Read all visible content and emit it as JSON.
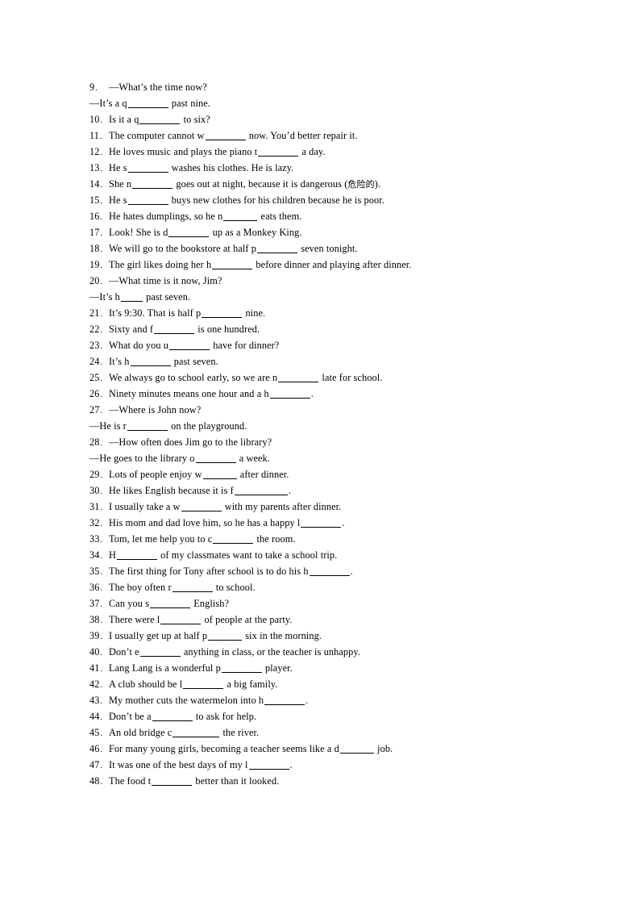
{
  "document": {
    "type": "worksheet",
    "page_background": "#ffffff",
    "text_color": "#000000",
    "items": [
      {
        "number": "9",
        "lines": [
          {
            "kind": "numbered",
            "parts": [
              {
                "t": "text",
                "v": "—What’s the time now?"
              }
            ]
          },
          {
            "kind": "cont",
            "parts": [
              {
                "t": "text",
                "v": "—It’s a q"
              },
              {
                "t": "blank",
                "size": "m"
              },
              {
                "t": "text",
                "v": " past nine."
              }
            ]
          }
        ]
      },
      {
        "number": "10",
        "lines": [
          {
            "kind": "numbered",
            "parts": [
              {
                "t": "text",
                "v": "Is it a q"
              },
              {
                "t": "blank",
                "size": "m"
              },
              {
                "t": "text",
                "v": " to six?"
              }
            ]
          }
        ]
      },
      {
        "number": "11",
        "lines": [
          {
            "kind": "numbered",
            "parts": [
              {
                "t": "text",
                "v": "The computer cannot w"
              },
              {
                "t": "blank",
                "size": "m"
              },
              {
                "t": "text",
                "v": " now. You’d better repair it."
              }
            ]
          }
        ]
      },
      {
        "number": "12",
        "lines": [
          {
            "kind": "numbered",
            "parts": [
              {
                "t": "text",
                "v": "He loves music and plays the piano t"
              },
              {
                "t": "blank",
                "size": "m"
              },
              {
                "t": "text",
                "v": " a day."
              }
            ]
          }
        ]
      },
      {
        "number": "13",
        "lines": [
          {
            "kind": "numbered",
            "parts": [
              {
                "t": "text",
                "v": "He s"
              },
              {
                "t": "blank",
                "size": "m"
              },
              {
                "t": "text",
                "v": " washes his clothes. He is lazy."
              }
            ]
          }
        ]
      },
      {
        "number": "14",
        "lines": [
          {
            "kind": "numbered",
            "parts": [
              {
                "t": "text",
                "v": "She n"
              },
              {
                "t": "blank",
                "size": "m"
              },
              {
                "t": "text",
                "v": " goes out at night, because it is dangerous ("
              },
              {
                "t": "cn",
                "v": "危险的"
              },
              {
                "t": "text",
                "v": ")."
              }
            ]
          }
        ]
      },
      {
        "number": "15",
        "lines": [
          {
            "kind": "numbered",
            "parts": [
              {
                "t": "text",
                "v": "He s"
              },
              {
                "t": "blank",
                "size": "m"
              },
              {
                "t": "text",
                "v": " buys new clothes for his children because he is poor."
              }
            ]
          }
        ]
      },
      {
        "number": "16",
        "lines": [
          {
            "kind": "numbered",
            "parts": [
              {
                "t": "text",
                "v": "He hates dumplings, so he n"
              },
              {
                "t": "blank",
                "size": "s"
              },
              {
                "t": "text",
                "v": " eats them."
              }
            ]
          }
        ]
      },
      {
        "number": "17",
        "lines": [
          {
            "kind": "numbered",
            "parts": [
              {
                "t": "text",
                "v": "Look! She is d"
              },
              {
                "t": "blank",
                "size": "m"
              },
              {
                "t": "text",
                "v": " up as a Monkey King."
              }
            ]
          }
        ]
      },
      {
        "number": "18",
        "lines": [
          {
            "kind": "numbered",
            "parts": [
              {
                "t": "text",
                "v": "We will go to the bookstore at half p"
              },
              {
                "t": "blank",
                "size": "m"
              },
              {
                "t": "text",
                "v": " seven tonight."
              }
            ]
          }
        ]
      },
      {
        "number": "19",
        "lines": [
          {
            "kind": "numbered",
            "parts": [
              {
                "t": "text",
                "v": "The girl likes doing her h"
              },
              {
                "t": "blank",
                "size": "m"
              },
              {
                "t": "text",
                "v": " before dinner and playing after dinner."
              }
            ]
          }
        ]
      },
      {
        "number": "20",
        "lines": [
          {
            "kind": "numbered",
            "parts": [
              {
                "t": "text",
                "v": "—What time is it now, Jim?"
              }
            ]
          },
          {
            "kind": "cont",
            "parts": [
              {
                "t": "text",
                "v": "—It’s h"
              },
              {
                "t": "blank",
                "size": "xs"
              },
              {
                "t": "text",
                "v": " past seven."
              }
            ]
          }
        ]
      },
      {
        "number": "21",
        "lines": [
          {
            "kind": "numbered",
            "parts": [
              {
                "t": "text",
                "v": "It’s 9:30. That is half p"
              },
              {
                "t": "blank",
                "size": "m"
              },
              {
                "t": "text",
                "v": " nine."
              }
            ]
          }
        ]
      },
      {
        "number": "22",
        "lines": [
          {
            "kind": "numbered",
            "parts": [
              {
                "t": "text",
                "v": "Sixty and f"
              },
              {
                "t": "blank",
                "size": "m"
              },
              {
                "t": "text",
                "v": " is one hundred."
              }
            ]
          }
        ]
      },
      {
        "number": "23",
        "lines": [
          {
            "kind": "numbered",
            "parts": [
              {
                "t": "text",
                "v": "What do you u"
              },
              {
                "t": "blank",
                "size": "m"
              },
              {
                "t": "text",
                "v": " have for dinner?"
              }
            ]
          }
        ]
      },
      {
        "number": "24",
        "lines": [
          {
            "kind": "numbered",
            "parts": [
              {
                "t": "text",
                "v": "It’s h"
              },
              {
                "t": "blank",
                "size": "m"
              },
              {
                "t": "text",
                "v": " past seven."
              }
            ]
          }
        ]
      },
      {
        "number": "25",
        "lines": [
          {
            "kind": "numbered",
            "parts": [
              {
                "t": "text",
                "v": "We always go to school early, so we are n"
              },
              {
                "t": "blank",
                "size": "m"
              },
              {
                "t": "text",
                "v": " late for school."
              }
            ]
          }
        ]
      },
      {
        "number": "26",
        "lines": [
          {
            "kind": "numbered",
            "parts": [
              {
                "t": "text",
                "v": "Ninety minutes means one hour and a h"
              },
              {
                "t": "blank",
                "size": "m"
              },
              {
                "t": "text",
                "v": "."
              }
            ]
          }
        ]
      },
      {
        "number": "27",
        "lines": [
          {
            "kind": "numbered",
            "parts": [
              {
                "t": "text",
                "v": "—Where is John now?"
              }
            ]
          },
          {
            "kind": "cont",
            "parts": [
              {
                "t": "text",
                "v": "—He is r"
              },
              {
                "t": "blank",
                "size": "m"
              },
              {
                "t": "text",
                "v": " on the playground."
              }
            ]
          }
        ]
      },
      {
        "number": "28",
        "lines": [
          {
            "kind": "numbered",
            "parts": [
              {
                "t": "text",
                "v": "—How often does Jim go to the library?"
              }
            ]
          },
          {
            "kind": "cont",
            "parts": [
              {
                "t": "text",
                "v": "—He goes to the library o"
              },
              {
                "t": "blank",
                "size": "m"
              },
              {
                "t": "text",
                "v": " a week."
              }
            ]
          }
        ]
      },
      {
        "number": "29",
        "lines": [
          {
            "kind": "numbered",
            "parts": [
              {
                "t": "text",
                "v": "Lots of people enjoy w"
              },
              {
                "t": "blank",
                "size": "s"
              },
              {
                "t": "text",
                "v": " after dinner."
              }
            ]
          }
        ]
      },
      {
        "number": "30",
        "lines": [
          {
            "kind": "numbered",
            "parts": [
              {
                "t": "text",
                "v": "He likes English because it is f"
              },
              {
                "t": "blank",
                "size": "xl"
              },
              {
                "t": "text",
                "v": "."
              }
            ]
          }
        ]
      },
      {
        "number": "31",
        "lines": [
          {
            "kind": "numbered",
            "parts": [
              {
                "t": "text",
                "v": "I usually take a w"
              },
              {
                "t": "blank",
                "size": "m"
              },
              {
                "t": "text",
                "v": " with my parents after dinner."
              }
            ]
          }
        ]
      },
      {
        "number": "32",
        "lines": [
          {
            "kind": "numbered",
            "parts": [
              {
                "t": "text",
                "v": "His mom and dad love him, so he has a happy l"
              },
              {
                "t": "blank",
                "size": "m"
              },
              {
                "t": "text",
                "v": "."
              }
            ]
          }
        ]
      },
      {
        "number": "33",
        "lines": [
          {
            "kind": "numbered",
            "parts": [
              {
                "t": "text",
                "v": "Tom, let me help you to c"
              },
              {
                "t": "blank",
                "size": "m"
              },
              {
                "t": "text",
                "v": " the room."
              }
            ]
          }
        ]
      },
      {
        "number": "34",
        "lines": [
          {
            "kind": "numbered",
            "parts": [
              {
                "t": "text",
                "v": "H"
              },
              {
                "t": "blank",
                "size": "m"
              },
              {
                "t": "text",
                "v": " of my classmates want to take a school trip."
              }
            ]
          }
        ]
      },
      {
        "number": "35",
        "lines": [
          {
            "kind": "numbered",
            "parts": [
              {
                "t": "text",
                "v": "The first thing for Tony after school is to do his h"
              },
              {
                "t": "blank",
                "size": "m"
              },
              {
                "t": "text",
                "v": "."
              }
            ]
          }
        ]
      },
      {
        "number": "36",
        "lines": [
          {
            "kind": "numbered",
            "parts": [
              {
                "t": "text",
                "v": "The boy often r"
              },
              {
                "t": "blank",
                "size": "m"
              },
              {
                "t": "text",
                "v": " to school."
              }
            ]
          }
        ]
      },
      {
        "number": "37",
        "lines": [
          {
            "kind": "numbered",
            "parts": [
              {
                "t": "text",
                "v": "Can you s"
              },
              {
                "t": "blank",
                "size": "m"
              },
              {
                "t": "text",
                "v": " English?"
              }
            ]
          }
        ]
      },
      {
        "number": "38",
        "lines": [
          {
            "kind": "numbered",
            "parts": [
              {
                "t": "text",
                "v": "There were l"
              },
              {
                "t": "blank",
                "size": "m"
              },
              {
                "t": "text",
                "v": " of people at the party."
              }
            ]
          }
        ]
      },
      {
        "number": "39",
        "lines": [
          {
            "kind": "numbered",
            "parts": [
              {
                "t": "text",
                "v": "I usually get up at half p"
              },
              {
                "t": "blank",
                "size": "s"
              },
              {
                "t": "text",
                "v": " six in the morning."
              }
            ]
          }
        ]
      },
      {
        "number": "40",
        "lines": [
          {
            "kind": "numbered",
            "parts": [
              {
                "t": "text",
                "v": "Don’t e"
              },
              {
                "t": "blank",
                "size": "m"
              },
              {
                "t": "text",
                "v": " anything in class, or the teacher is unhappy."
              }
            ]
          }
        ]
      },
      {
        "number": "41",
        "lines": [
          {
            "kind": "numbered",
            "parts": [
              {
                "t": "text",
                "v": "Lang Lang is a wonderful p"
              },
              {
                "t": "blank",
                "size": "m"
              },
              {
                "t": "text",
                "v": " player."
              }
            ]
          }
        ]
      },
      {
        "number": "42",
        "lines": [
          {
            "kind": "numbered",
            "parts": [
              {
                "t": "text",
                "v": "A club should be l"
              },
              {
                "t": "blank",
                "size": "m"
              },
              {
                "t": "text",
                "v": " a big family."
              }
            ]
          }
        ]
      },
      {
        "number": "43",
        "lines": [
          {
            "kind": "numbered",
            "parts": [
              {
                "t": "text",
                "v": "My mother cuts the watermelon into h"
              },
              {
                "t": "blank",
                "size": "m"
              },
              {
                "t": "text",
                "v": "."
              }
            ]
          }
        ]
      },
      {
        "number": "44",
        "lines": [
          {
            "kind": "numbered",
            "parts": [
              {
                "t": "text",
                "v": "Don’t be a"
              },
              {
                "t": "blank",
                "size": "m"
              },
              {
                "t": "text",
                "v": " to ask for help."
              }
            ]
          }
        ]
      },
      {
        "number": "45",
        "lines": [
          {
            "kind": "numbered",
            "parts": [
              {
                "t": "text",
                "v": "An old bridge c"
              },
              {
                "t": "blank",
                "size": "l"
              },
              {
                "t": "text",
                "v": " the river."
              }
            ]
          }
        ]
      },
      {
        "number": "46",
        "lines": [
          {
            "kind": "numbered",
            "parts": [
              {
                "t": "text",
                "v": "For many young girls, becoming a teacher seems like a d"
              },
              {
                "t": "blank",
                "size": "s"
              },
              {
                "t": "text",
                "v": " job."
              }
            ]
          }
        ]
      },
      {
        "number": "47",
        "lines": [
          {
            "kind": "numbered",
            "parts": [
              {
                "t": "text",
                "v": "It was one of the best days of my l"
              },
              {
                "t": "blank",
                "size": "m"
              },
              {
                "t": "text",
                "v": "."
              }
            ]
          }
        ]
      },
      {
        "number": "48",
        "lines": [
          {
            "kind": "numbered",
            "parts": [
              {
                "t": "text",
                "v": "The food t"
              },
              {
                "t": "blank",
                "size": "m"
              },
              {
                "t": "text",
                "v": " better than it looked."
              }
            ]
          }
        ]
      }
    ]
  }
}
